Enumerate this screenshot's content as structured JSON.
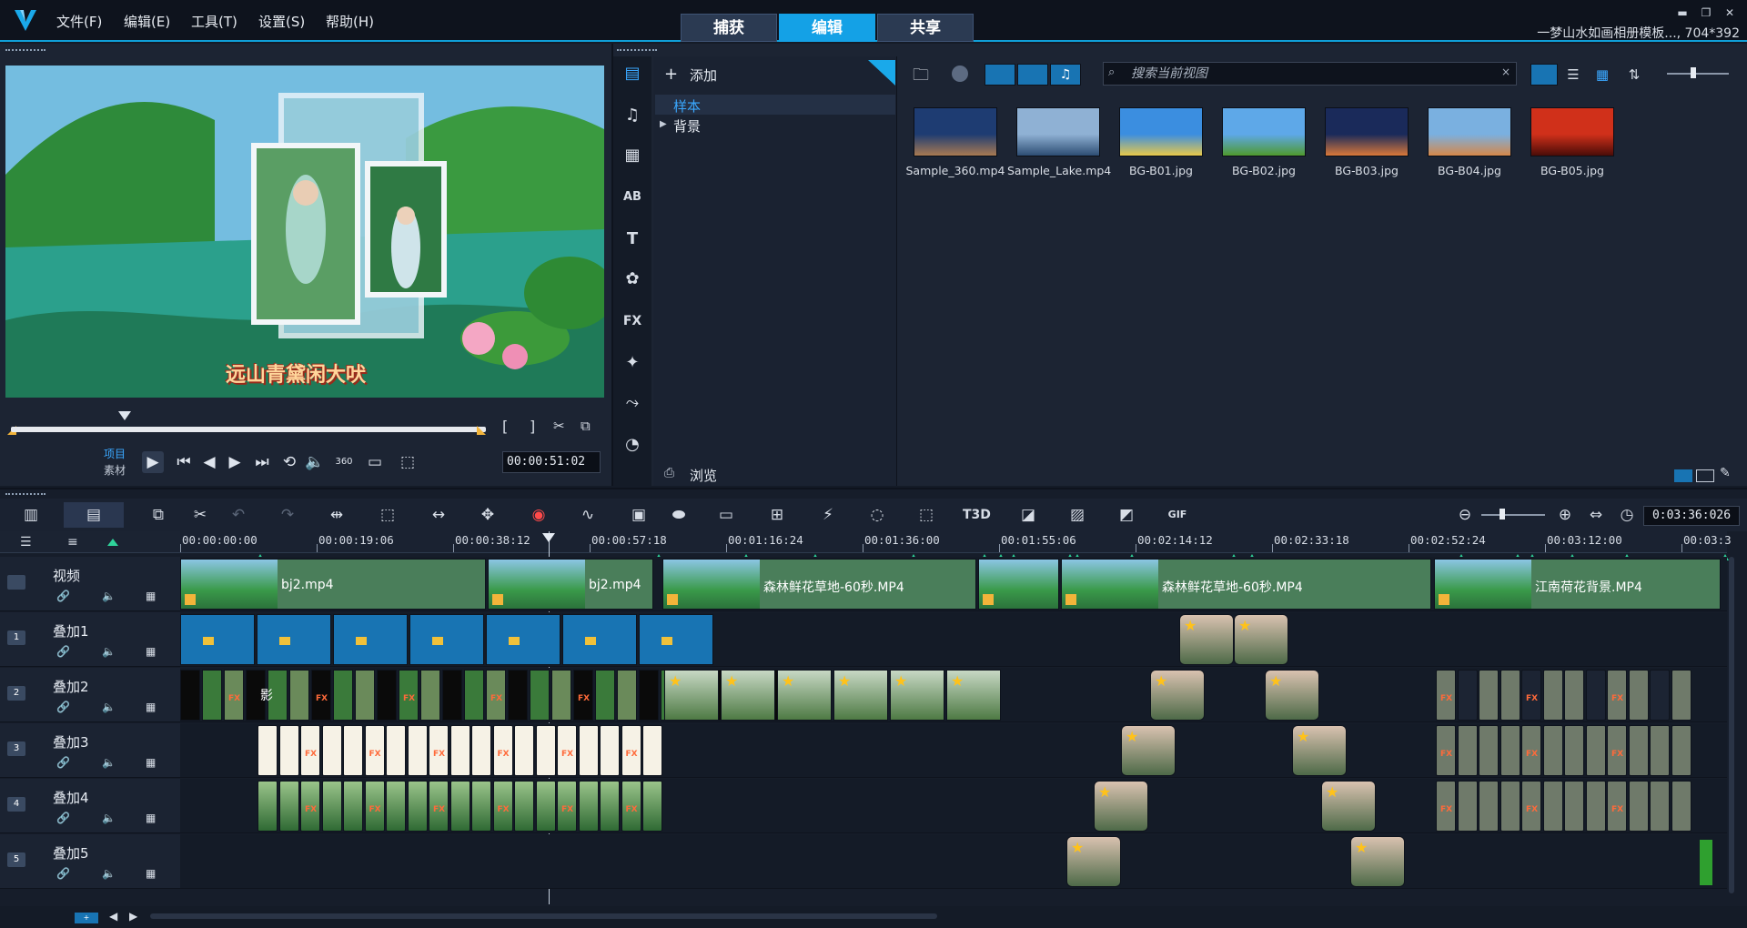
{
  "menu": [
    "文件(F)",
    "编辑(E)",
    "工具(T)",
    "设置(S)",
    "帮助(H)"
  ],
  "mode_tabs": {
    "capture": "捕获",
    "edit": "编辑",
    "share": "共享",
    "active": "edit"
  },
  "project_title": "一梦山水如画相册模板..., 704*392",
  "preview": {
    "caption": "远山青黛闲大吠",
    "mode_project": "项目",
    "mode_clip": "素材",
    "timecode": "00:00:51:02",
    "icons": [
      "mark-in-icon",
      "mark-out-icon",
      "split-icon",
      "resize-icon",
      "play-icon",
      "home-icon",
      "prev-frame-icon",
      "next-frame-icon",
      "end-icon",
      "repeat-icon",
      "volume-icon",
      "360-icon",
      "aspect-icon",
      "display-icon"
    ]
  },
  "library": {
    "add_label": "添加",
    "tree": [
      {
        "label": "样本",
        "selected": true
      },
      {
        "label": "背景",
        "selected": false
      }
    ],
    "browse_label": "浏览",
    "search_placeholder": "搜索当前视图",
    "thumbnails": [
      {
        "label": "Sample_360.mp4",
        "colors": [
          "#1e3c72",
          "#a87a52"
        ]
      },
      {
        "label": "Sample_Lake.mp4",
        "colors": [
          "#8fb1d4",
          "#2d4d73"
        ]
      },
      {
        "label": "BG-B01.jpg",
        "colors": [
          "#3b8ee0",
          "#e8c94a"
        ]
      },
      {
        "label": "BG-B02.jpg",
        "colors": [
          "#5ea8e8",
          "#4f9a2e"
        ]
      },
      {
        "label": "BG-B03.jpg",
        "colors": [
          "#1a2a5a",
          "#d8783a"
        ]
      },
      {
        "label": "BG-B04.jpg",
        "colors": [
          "#7ab0e0",
          "#d6884a"
        ]
      },
      {
        "label": "BG-B05.jpg",
        "colors": [
          "#d0301a",
          "#4a0c08"
        ]
      }
    ]
  },
  "timeline": {
    "duration": "0:03:36:026",
    "ruler": [
      "00:00:00:00",
      "00:00:19:06",
      "00:00:38:12",
      "00:00:57:18",
      "00:01:16:24",
      "00:01:36:00",
      "00:01:55:06",
      "00:02:14:12",
      "00:02:33:18",
      "00:02:52:24",
      "00:03:12:00",
      "00:03:3"
    ],
    "tracks": [
      {
        "name": "视频",
        "num": ""
      },
      {
        "name": "叠加1",
        "num": "1"
      },
      {
        "name": "叠加2",
        "num": "2"
      },
      {
        "name": "叠加3",
        "num": "3"
      },
      {
        "name": "叠加4",
        "num": "4"
      },
      {
        "name": "叠加5",
        "num": "5"
      }
    ],
    "video_clips": [
      {
        "label": "bj2.mp4",
        "start": 0,
        "end": 336
      },
      {
        "label": "bj2.mp4",
        "start": 338,
        "end": 520
      },
      {
        "label": "森林鲜花草地-60秒.MP4",
        "start": 530,
        "end": 875
      },
      {
        "label": "",
        "start": 877,
        "end": 966
      },
      {
        "label": "森林鲜花草地-60秒.MP4",
        "start": 968,
        "end": 1375
      },
      {
        "label": "江南荷花背景.MP4",
        "start": 1378,
        "end": 1693
      }
    ],
    "overlay_text": "影"
  }
}
